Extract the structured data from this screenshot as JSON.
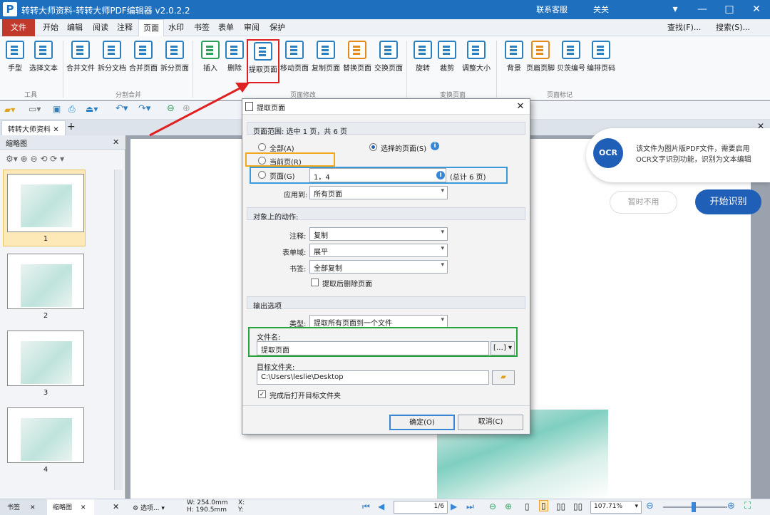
{
  "titlebar": {
    "app_title": "转转大师资料-转转大师PDF编辑器 v2.0.2.2",
    "service": "联系客服",
    "user": "关关",
    "colors": {
      "bar": "#1f6fbf",
      "file_tab": "#c0392b"
    }
  },
  "menu": {
    "file": "文件",
    "items": [
      "开始",
      "编辑",
      "阅读",
      "注释",
      "页面",
      "水印",
      "书签",
      "表单",
      "审阅",
      "保护"
    ],
    "find": "查找(F)...",
    "search": "搜索(S)..."
  },
  "ribbon": {
    "tools": [
      "手型",
      "选择文本"
    ],
    "split_merge": [
      "合并文件",
      "拆分文档",
      "合并页面",
      "拆分页面"
    ],
    "page_edit": [
      "插入",
      "删除",
      "提取页面",
      "移动页面",
      "复制页面",
      "替换页面",
      "交换页面"
    ],
    "transform": [
      "旋转",
      "裁剪",
      "调整大小"
    ],
    "page_marks": [
      "背景",
      "页眉页脚",
      "贝茨编号",
      "编排页码"
    ],
    "groups": [
      "工具",
      "分割合并",
      "页面修改",
      "变换页面",
      "页面标记"
    ]
  },
  "doc_tab": "转转大师资料",
  "sidebar": {
    "title": "缩略图",
    "pages": [
      "1",
      "2",
      "3",
      "4"
    ],
    "bottom_tabs": [
      "书签",
      "缩略图"
    ]
  },
  "ocr": {
    "badge": "OCR",
    "message": "该文件为图片版PDF文件，需要启用OCR文字识别功能，识别为文本编辑",
    "later": "暂时不用",
    "start": "开始识别"
  },
  "dialog": {
    "title": "提取页面",
    "range_header": "页面范围: 选中 1 页，共 6 页",
    "all": "全部(A)",
    "selected": "选择的页面(S)",
    "current": "当前页(R)",
    "pages": "页面(G)",
    "pages_value": "1，4",
    "total": "(总计 6 页)",
    "apply_to_label": "应用到:",
    "apply_to_value": "所有页面",
    "actions_header": "对象上的动作:",
    "annot_label": "注释:",
    "annot_value": "复制",
    "form_label": "表单域:",
    "form_value": "展平",
    "bookmark_label": "书签:",
    "bookmark_value": "全部复制",
    "delete_after": "提取后删除页面",
    "output_header": "输出选项",
    "type_label": "类型:",
    "type_value": "提取所有页面到一个文件",
    "filename_label": "文件名:",
    "filename_value": "提取页面",
    "folder_label": "目标文件夹:",
    "folder_value": "C:\\Users\\leslie\\Desktop",
    "open_after": "完成后打开目标文件夹",
    "ok": "确定(O)",
    "cancel": "取消(C)"
  },
  "status": {
    "options": "选项...",
    "size_w": "W: 254.0mm",
    "size_h": "H: 190.5mm",
    "coord_x": "X:",
    "coord_y": "Y:",
    "page_current": "1",
    "page_total": "6",
    "zoom": "107.71%"
  }
}
